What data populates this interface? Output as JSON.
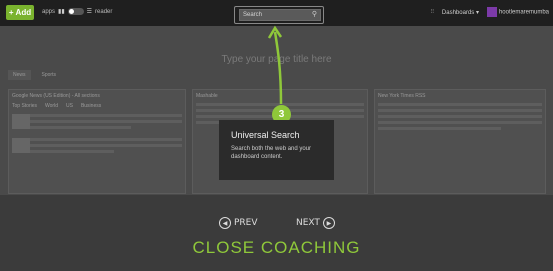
{
  "topbar": {
    "add_label": "Add",
    "mode_label": "apps",
    "mode_right_label": "reader",
    "search_placeholder": "Search",
    "dashboards_label": "Dashboards",
    "username": "hootlemaremumba"
  },
  "workspace": {
    "page_title": "Type your page title here",
    "tabs": [
      "News",
      "Sports"
    ],
    "panels": [
      {
        "title": "Google News (US Edition) - All sections",
        "subtabs": [
          "Top Stories",
          "World",
          "US",
          "Business"
        ]
      },
      {
        "title": "Mashable",
        "subtabs": []
      },
      {
        "title": "New York Times RSS",
        "subtabs": []
      }
    ]
  },
  "coaching": {
    "step_number": "3",
    "tooltip_title": "Universal Search",
    "tooltip_body": "Search both the web and your dashboard content.",
    "prev_label": "PREV",
    "next_label": "NEXT",
    "close_label": "CLOSE COACHING",
    "accent_color": "#8fc83a"
  }
}
